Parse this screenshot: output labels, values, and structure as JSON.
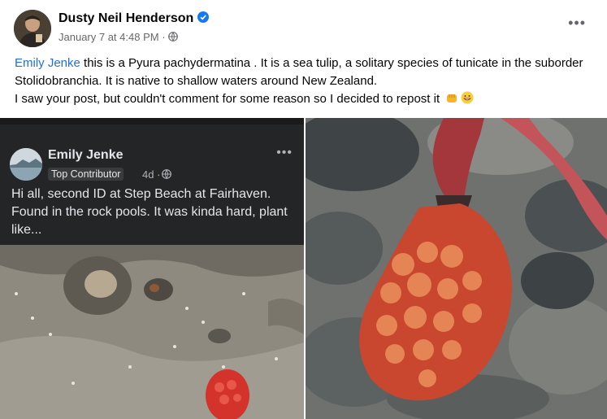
{
  "post": {
    "author": "Dusty Neil Henderson",
    "date": "January 7 at 4:48 PM",
    "separator": "·",
    "more": "•••",
    "mention": "Emily Jenke",
    "body_line1": " this is a Pyura pachydermatina . It is a sea tulip, a solitary species of tunicate in the suborder Stolidobranchia. It is native to shallow waters around New Zealand.",
    "body_line2": "I saw your post, but couldn't comment for some reason so I decided to repost it"
  },
  "shared_screenshot": {
    "author": "Emily Jenke",
    "badge": "Top Contributor",
    "time": "4d ·",
    "more": "•••",
    "text": "Hi all, second ID at Step Beach at Fairhaven. Found in the rock pools. It was kinda hard, plant like..."
  },
  "icons": [
    "verified-badge-icon",
    "globe-icon",
    "fist-emoji-icon",
    "grin-emoji-icon",
    "more-icon"
  ],
  "colors": {
    "mention": "#216fdb",
    "verified": "#1877f2",
    "secondary_text": "#65676b",
    "dark_post_bg": "#242526"
  }
}
